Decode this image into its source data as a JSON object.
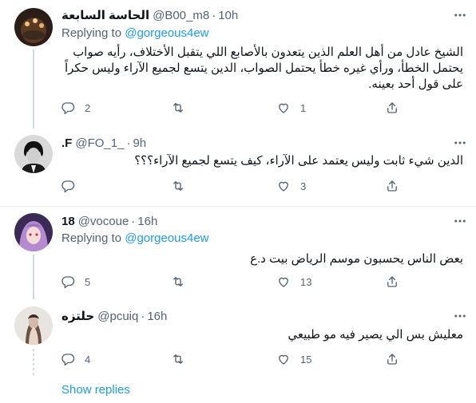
{
  "tweets": [
    {
      "name": "الحاسة السابعة",
      "handle": "@B00_m8",
      "time": "10h",
      "reply_prefix": "Replying to ",
      "reply_mention": "@gorgeous4ew",
      "body": "الشيخ عادل من أهل العلم الذين يتعدون بالأصابع اللي يتقبل الأختلاف، رأيه صواب يحتمل الخطأ، ورأي غيره خطأ يحتمل الصواب، الدين يتسع لجميع الآراء وليس حكراً على قول أحد بعينه.",
      "replies": "2",
      "retweets": "",
      "likes": "1"
    },
    {
      "name": "F.",
      "handle": "@FO_1_",
      "time": "9h",
      "body": "الدين شيء ثابت وليس يعتمد على الآراء، كيف يتسع لجميع الآراء؟؟؟",
      "replies": "",
      "retweets": "",
      "likes": "3"
    },
    {
      "name": "18",
      "handle": "@vocoue",
      "time": "16h",
      "reply_prefix": "Replying to ",
      "reply_mention": "@gorgeous4ew",
      "body": "بعض الناس يحسبون موسم الرياض بيت د.ع",
      "replies": "5",
      "retweets": "",
      "likes": "13"
    },
    {
      "name": "حلتزه",
      "handle": "@pcuiq",
      "time": "16h",
      "body": "معليش بس الي يصير فيه مو طبيعي",
      "replies": "4",
      "retweets": "",
      "likes": "15"
    }
  ],
  "separator": "·",
  "show_replies": "Show replies",
  "icons": [
    "more-icon",
    "reply-icon",
    "retweet-icon",
    "like-icon",
    "share-icon"
  ],
  "colors": {
    "text": "#0f1419",
    "muted": "#536471",
    "link": "#1d9bf0",
    "line": "#cfd9de"
  }
}
